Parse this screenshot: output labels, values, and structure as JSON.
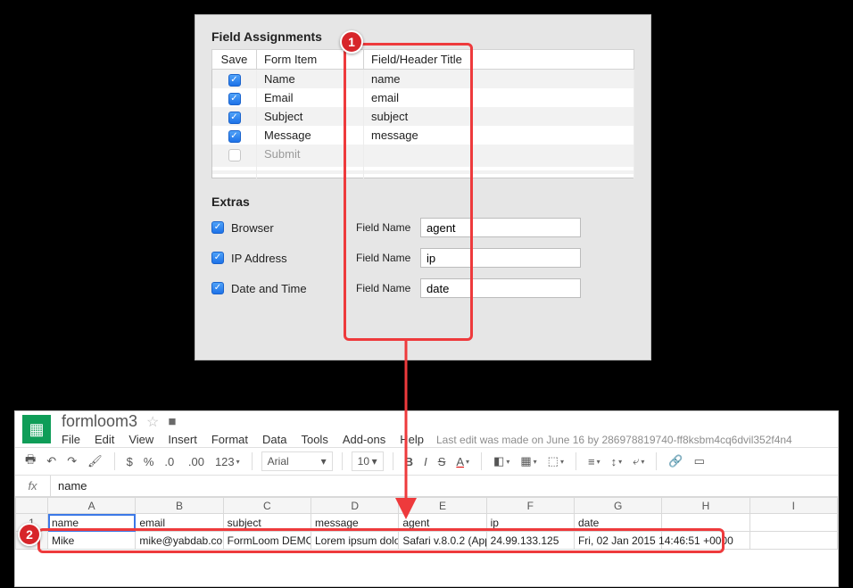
{
  "panel": {
    "title": "Field Assignments",
    "columns": {
      "save": "Save",
      "form_item": "Form Item",
      "field_title": "Field/Header Title"
    },
    "rows": [
      {
        "checked": true,
        "form_item": "Name",
        "field": "name"
      },
      {
        "checked": true,
        "form_item": "Email",
        "field": "email"
      },
      {
        "checked": true,
        "form_item": "Subject",
        "field": "subject"
      },
      {
        "checked": true,
        "form_item": "Message",
        "field": "message"
      },
      {
        "checked": false,
        "form_item": "Submit",
        "field": ""
      }
    ],
    "extras_title": "Extras",
    "field_name_label": "Field Name",
    "extras": [
      {
        "label": "Browser",
        "value": "agent"
      },
      {
        "label": "IP Address",
        "value": "ip"
      },
      {
        "label": "Date and Time",
        "value": "date"
      }
    ]
  },
  "sheets": {
    "doc_name": "formloom3",
    "menus": [
      "File",
      "Edit",
      "View",
      "Insert",
      "Format",
      "Data",
      "Tools",
      "Add-ons",
      "Help"
    ],
    "last_edit": "Last edit was made on June 16 by 286978819740-ff8ksbm4cq6dvil352f4n4",
    "font": "Arial",
    "font_size": "10",
    "formula_value": "name",
    "col_letters": [
      "A",
      "B",
      "C",
      "D",
      "E",
      "F",
      "G",
      "H",
      "I"
    ],
    "header_row": [
      "name",
      "email",
      "subject",
      "message",
      "agent",
      "ip",
      "date",
      "",
      ""
    ],
    "data_row": [
      "Mike",
      "mike@yabdab.co",
      "FormLoom DEMO",
      "Lorem ipsum dolo",
      "Safari v.8.0.2 (App",
      "24.99.133.125",
      "Fri, 02 Jan 2015 14:46:51 +0000",
      "",
      ""
    ]
  },
  "callouts": {
    "one": "1",
    "two": "2"
  }
}
